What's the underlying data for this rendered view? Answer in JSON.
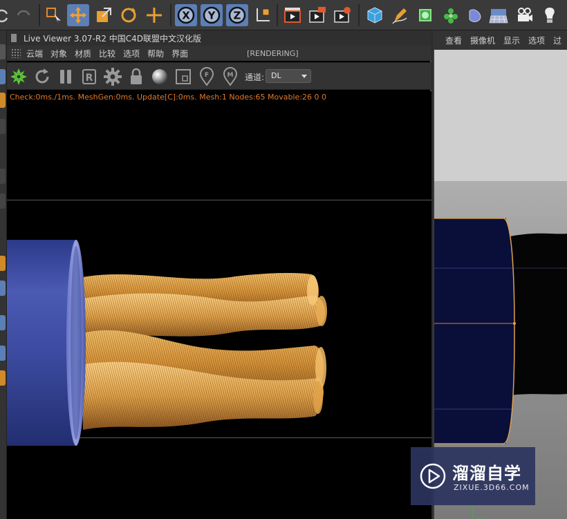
{
  "toolbar": {
    "buttons": [
      "undo-icon",
      "redo-icon",
      "select-icon",
      "move-icon",
      "scale-icon",
      "rotate-icon",
      "live-select-icon",
      "x-axis-icon",
      "y-axis-icon",
      "z-axis-icon",
      "coordinate-system-icon",
      "render-view-icon",
      "render-to-picture-viewer-icon",
      "render-settings-icon",
      "cube-icon",
      "pen-icon",
      "subdivision-icon",
      "cloner-icon",
      "deformer-icon",
      "floor-icon",
      "camera-icon",
      "light-icon"
    ],
    "axis_x": "X",
    "axis_y": "Y",
    "axis_z": "Z"
  },
  "live_viewer": {
    "title": "Live Viewer 3.07-R2 中国C4D联盟中文汉化版",
    "menu": [
      "云端",
      "对象",
      "材质",
      "比较",
      "选项",
      "帮助",
      "界面"
    ],
    "status": "[RENDERING]",
    "icons": [
      "octane-logo-icon",
      "refresh-icon",
      "pause-icon",
      "r-lock-icon",
      "settings-gear-icon",
      "lock-icon",
      "material-sphere-icon",
      "region-render-icon",
      "focus-pick-icon",
      "material-pick-icon"
    ],
    "lock_letter": "R",
    "focus_letter": "F",
    "material_letter": "M",
    "channel_label": "通道:",
    "channel_value": "DL",
    "stats": "Check:0ms./1ms. MeshGen:0ms. Update[C]:0ms. Mesh:1 Nodes:65 Movable:26  0 0"
  },
  "editor": {
    "menu": [
      "查看",
      "摄像机",
      "显示",
      "选项",
      "过"
    ]
  },
  "watermark": {
    "title": "溜溜自学",
    "url": "ZIXUE.3D66.COM"
  },
  "colors": {
    "selected_tool": "#5b7fb6",
    "stats_text": "#e07a2a",
    "sleeve_blue": "#3a4aa0",
    "copper": "#d8953a",
    "watermark_bg": "#2c3460"
  }
}
